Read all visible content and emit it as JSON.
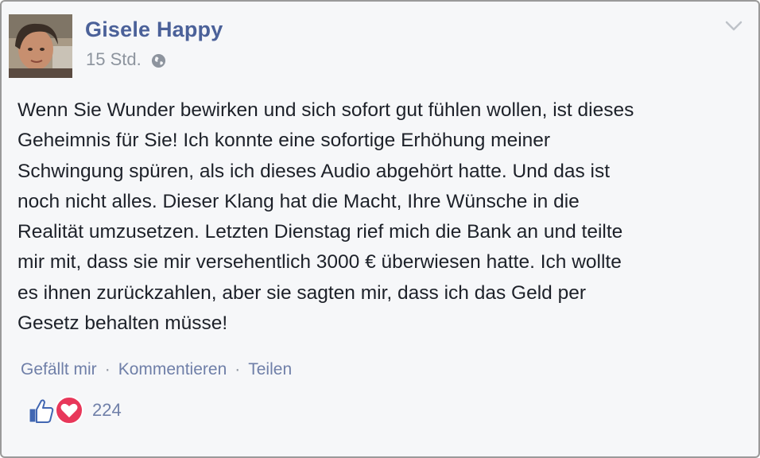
{
  "post": {
    "author": "Gisele Happy",
    "time": "15 Std.",
    "privacy_icon": "globe-icon",
    "menu_icon": "chevron-down-icon",
    "text": "Wenn Sie Wunder bewirken und sich sofort gut fühlen wollen, ist dieses\nGeheimnis für Sie! Ich konnte eine sofortige Erhöhung meiner\nSchwingung spüren, als ich dieses Audio abgehört hatte. Und das ist\nnoch nicht alles. Dieser Klang hat die Macht, Ihre Wünsche in die\nRealität umzusetzen. Letzten Dienstag rief mich die Bank an und teilte\nmir mit, dass sie mir versehentlich 3000 € überwiesen hatte. Ich wollte\nes ihnen zurückzahlen, aber sie sagten mir, dass ich das Geld per\nGesetz behalten müsse!"
  },
  "actions": {
    "like": "Gefällt mir",
    "separator": "·",
    "comment": "Kommentieren",
    "share": "Teilen"
  },
  "reactions": {
    "icons": [
      "like-icon",
      "love-icon"
    ],
    "count": "224"
  },
  "colors": {
    "author": "#4b6199",
    "link": "#6f7fa8",
    "meta": "#8d949e",
    "text": "#1d2129",
    "like_blue": "#4267b2",
    "love_red": "#e8375a",
    "background": "#f6f7f9"
  }
}
